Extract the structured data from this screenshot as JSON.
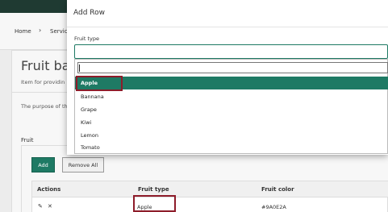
{
  "background": {
    "breadcrumb": [
      "Home",
      "Servic"
    ],
    "page_title": "Fruit bas",
    "subtitle": "Item for providin",
    "purpose_text": "The purpose of th",
    "fruit_label": "Fruit",
    "buttons": {
      "add": "Add",
      "remove_all": "Remove All"
    },
    "table": {
      "headers": [
        "Actions",
        "Fruit type",
        "Fruit color"
      ],
      "rows": [
        {
          "actions": [
            "edit-icon",
            "delete-icon"
          ],
          "fruit_type": "Apple",
          "fruit_color": "#9A0E2A"
        }
      ]
    }
  },
  "modal": {
    "title": "Add Row",
    "field_label": "Fruit type",
    "combo_value": "",
    "search_value": "",
    "options": [
      "Apple",
      "Bannana",
      "Grape",
      "Kiwi",
      "Lemon",
      "Tomato"
    ],
    "selected_option": "Apple"
  },
  "colors": {
    "accent": "#1e7a64",
    "highlight_box": "#8e1c2a",
    "topbar": "#1f3a32"
  }
}
